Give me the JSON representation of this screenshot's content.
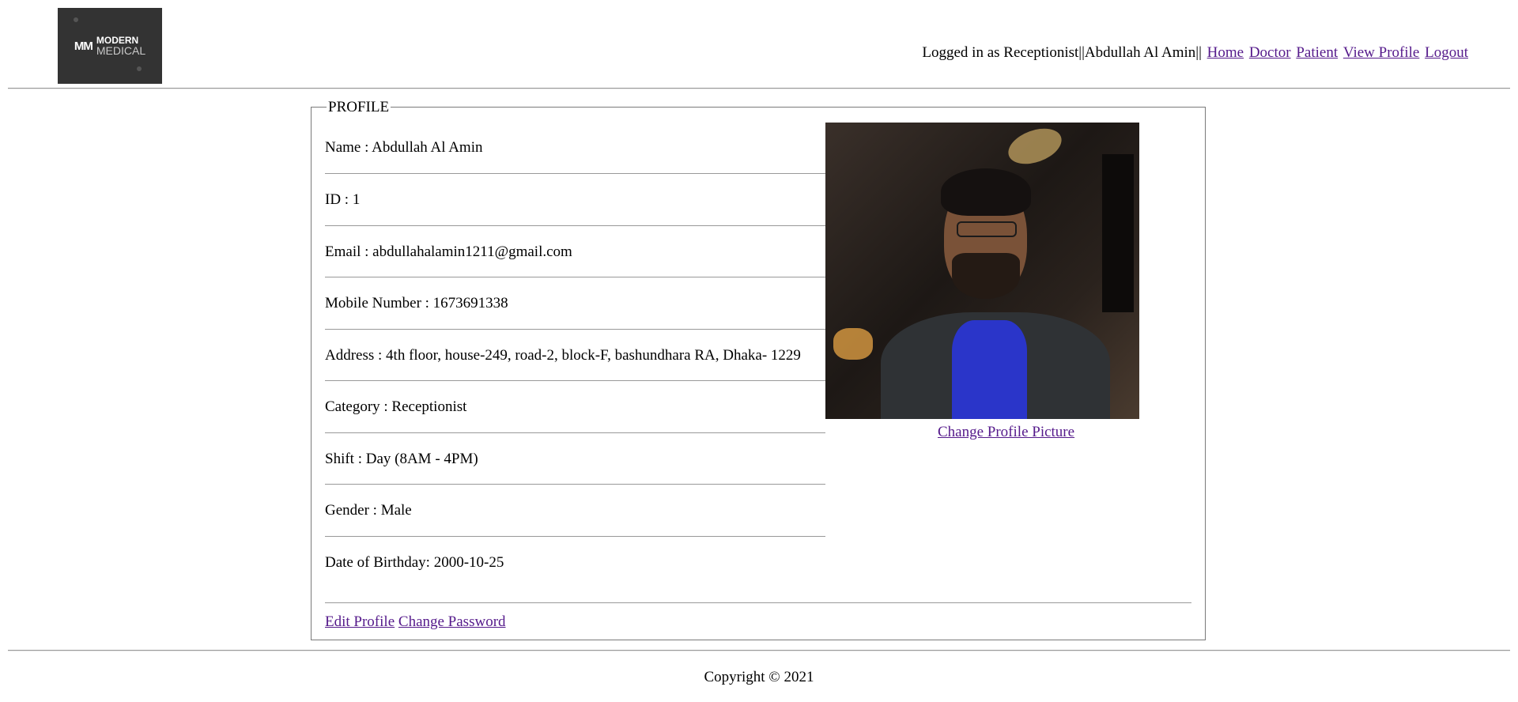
{
  "logo": {
    "mark": "MM",
    "line1": "MODERN",
    "line2": "MEDICAL"
  },
  "nav": {
    "status": "Logged in as Receptionist||Abdullah Al Amin||",
    "links": [
      "Home",
      "Doctor",
      "Patient",
      "View Profile",
      "Logout"
    ]
  },
  "profile": {
    "legend": "PROFILE",
    "fields": [
      "Name : Abdullah Al Amin",
      "ID : 1",
      "Email : abdullahalamin1211@gmail.com",
      "Mobile Number : 1673691338",
      "Address : 4th floor, house-249, road-2, block-F, bashundhara RA, Dhaka- 1229",
      "Category : Receptionist",
      "Shift : Day (8AM - 4PM)",
      "Gender : Male",
      "Date of Birthday: 2000-10-25"
    ],
    "change_picture": "Change Profile Picture",
    "edit_profile": "Edit Profile",
    "change_password": "Change Password"
  },
  "footer": {
    "copyright": "Copyright © 2021"
  }
}
